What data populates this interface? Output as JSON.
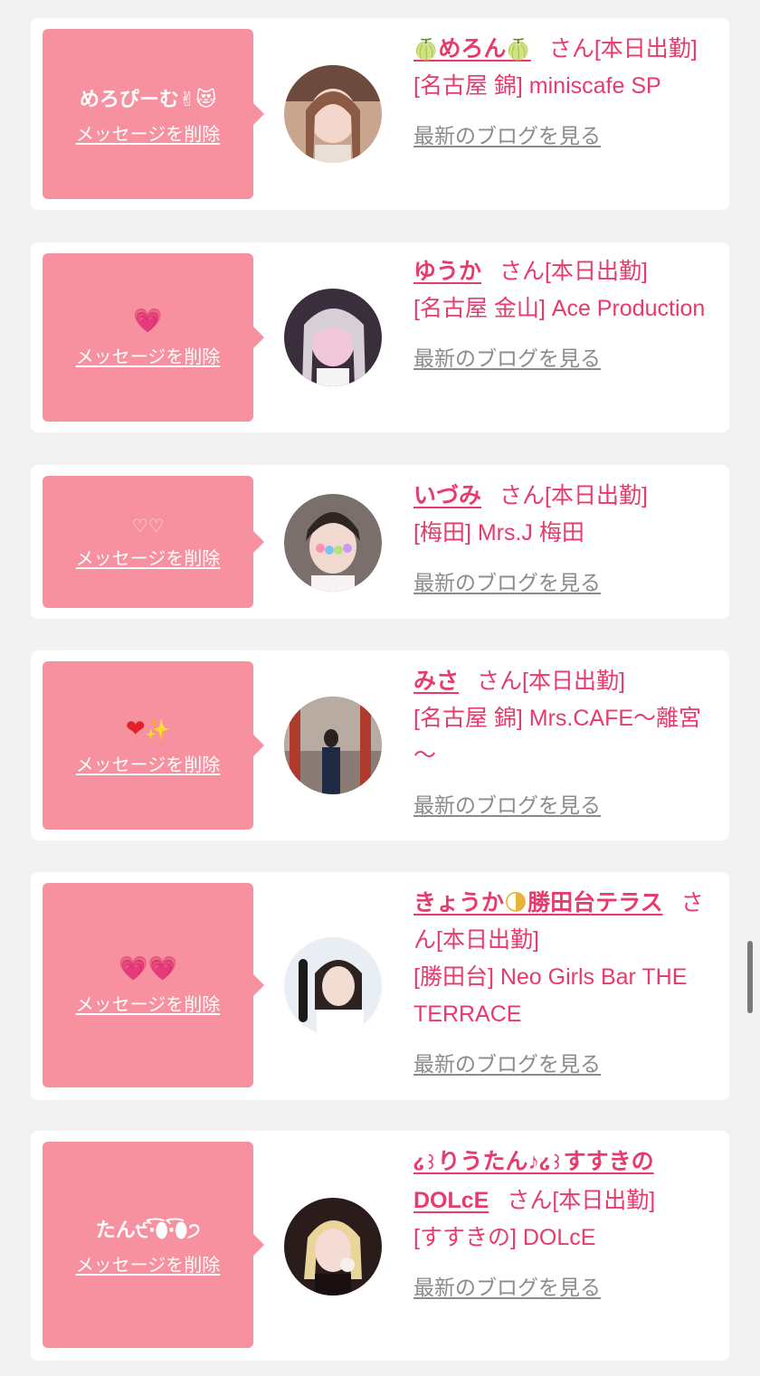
{
  "delete_label": "メッセージを削除",
  "blog_label": "最新のブログを見る",
  "san_suffix": "さん[本日出勤]",
  "colors": {
    "accent": "#e63b6c",
    "bubble": "#f7909f",
    "link_gray": "#8b8b8b",
    "background": "#f2f2f2"
  },
  "cards": [
    {
      "message": "めろぴーむ✌😻",
      "name": "めろん",
      "name_prefix": "🍈",
      "name_suffix": "🍈",
      "shop": "[名古屋 錦] miniscafe SP"
    },
    {
      "message": "💗",
      "name": "ゆうか",
      "shop": "[名古屋 金山] Ace Production"
    },
    {
      "message": "♡♡",
      "name": "いづみ",
      "shop": "[梅田] Mrs.J 梅田"
    },
    {
      "message_heart": "❤",
      "message_spark": "✨",
      "name": "みさ",
      "shop": "[名古屋 錦] Mrs.CAFE～離宮～"
    },
    {
      "message": "💗💗",
      "name": "きょうか",
      "name_moon": "🌗",
      "name_rest": "勝田台テラス",
      "shop": "[勝田台] Neo Girls Bar THE TERRACE"
    },
    {
      "message": "たん੯‧̀͡⬮‧̀͡⬮੭",
      "name_mark1": "໒꒱",
      "name_mid1": "りうたん♪",
      "name_mark2": "໒꒱",
      "name_rest": "すすきのDOLcE",
      "shop": "[すすきの] DOLcE"
    }
  ],
  "icons": {
    "avatars": [
      "avatar-photo-1",
      "avatar-photo-2",
      "avatar-photo-3",
      "avatar-photo-4",
      "avatar-photo-5",
      "avatar-photo-6"
    ]
  }
}
